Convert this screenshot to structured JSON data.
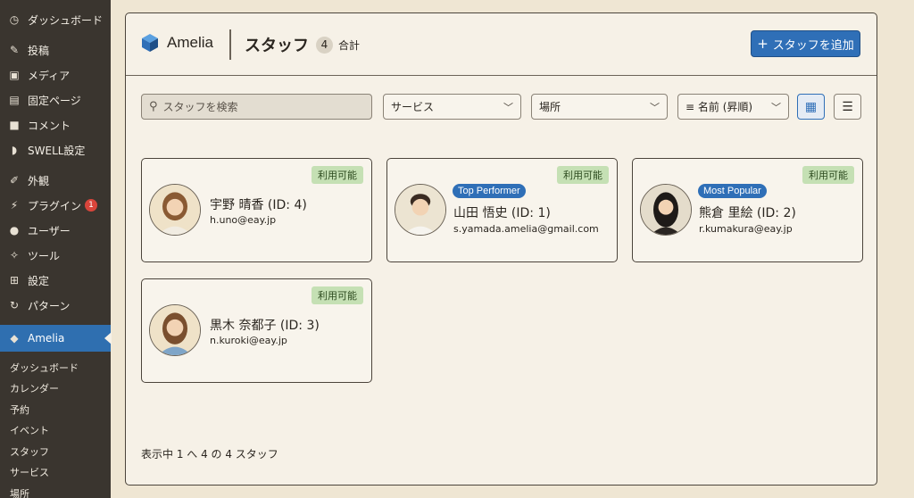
{
  "sidebar": {
    "items": [
      {
        "label": "ダッシュボード",
        "icon": "dashboard-icon"
      },
      {
        "label": "投稿",
        "icon": "pin-icon"
      },
      {
        "label": "メディア",
        "icon": "media-icon"
      },
      {
        "label": "固定ページ",
        "icon": "page-icon"
      },
      {
        "label": "コメント",
        "icon": "comment-icon"
      },
      {
        "label": "SWELL設定",
        "icon": "swell-icon"
      },
      {
        "label": "外観",
        "icon": "brush-icon"
      },
      {
        "label": "プラグイン",
        "icon": "plugin-icon",
        "badge": "1"
      },
      {
        "label": "ユーザー",
        "icon": "user-icon"
      },
      {
        "label": "ツール",
        "icon": "wrench-icon"
      },
      {
        "label": "設定",
        "icon": "settings-icon"
      },
      {
        "label": "パターン",
        "icon": "pattern-icon"
      },
      {
        "label": "Amelia",
        "icon": "amelia-icon"
      }
    ],
    "sub_items": [
      "ダッシュボード",
      "カレンダー",
      "予約",
      "イベント",
      "スタッフ",
      "サービス",
      "場所"
    ]
  },
  "header": {
    "logo_name": "Amelia",
    "title": "スタッフ",
    "count": "4",
    "count_suffix": "合計",
    "add_button": "スタッフを追加"
  },
  "filters": {
    "search_placeholder": "スタッフを検索",
    "service": "サービス",
    "location": "場所",
    "sort": "名前 (昇順)"
  },
  "staff": [
    {
      "name": "宇野 晴香 (ID: 4)",
      "email": "h.uno@eay.jp",
      "status": "利用可能",
      "tag": ""
    },
    {
      "name": "山田 悟史 (ID: 1)",
      "email": "s.yamada.amelia@gmail.com",
      "status": "利用可能",
      "tag": "Top Performer"
    },
    {
      "name": "熊倉 里絵 (ID: 2)",
      "email": "r.kumakura@eay.jp",
      "status": "利用可能",
      "tag": "Most Popular"
    },
    {
      "name": "黒木 奈都子 (ID: 3)",
      "email": "n.kuroki@eay.jp",
      "status": "利用可能",
      "tag": ""
    }
  ],
  "footer": {
    "text": "表示中 1 へ 4 の 4 スタッフ"
  },
  "colors": {
    "accent": "#2f6fb7",
    "available": "#c5e0b4",
    "sidebar": "#3a352f"
  }
}
